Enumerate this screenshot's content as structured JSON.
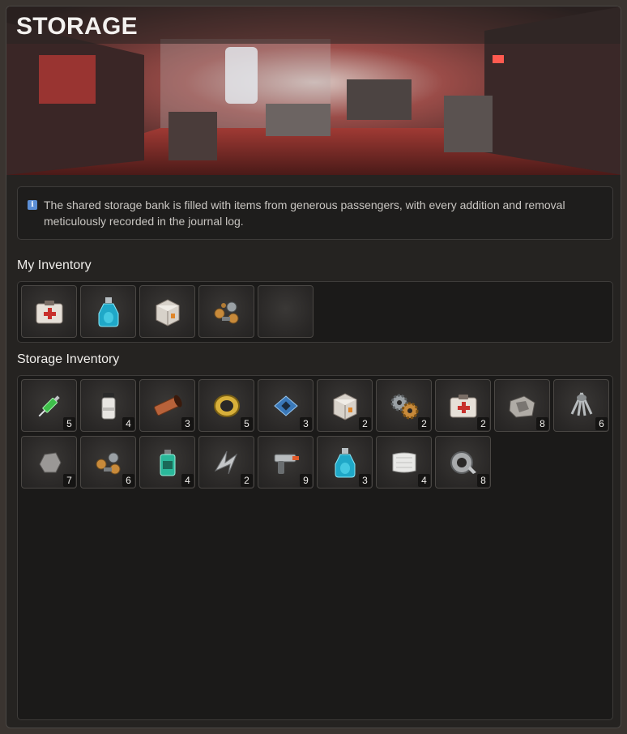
{
  "header": {
    "title": "STORAGE"
  },
  "notice": {
    "icon": "info-icon",
    "text": "The shared storage bank is filled with items from generous passengers, with every addition and removal meticulously recorded in the journal log."
  },
  "my_inventory": {
    "label": "My Inventory",
    "items": [
      {
        "icon": "medkit-icon"
      },
      {
        "icon": "potion-bottle-icon"
      },
      {
        "icon": "supply-crate-icon"
      },
      {
        "icon": "scrap-parts-icon"
      },
      {
        "icon": "empty-slot"
      }
    ]
  },
  "storage_inventory": {
    "label": "Storage Inventory",
    "items": [
      {
        "icon": "syringe-icon",
        "qty": "5"
      },
      {
        "icon": "canister-icon",
        "qty": "4"
      },
      {
        "icon": "copper-pipe-icon",
        "qty": "3"
      },
      {
        "icon": "metal-ring-icon",
        "qty": "5"
      },
      {
        "icon": "circuit-board-icon",
        "qty": "3"
      },
      {
        "icon": "supply-crate-icon",
        "qty": "2"
      },
      {
        "icon": "gears-icon",
        "qty": "2"
      },
      {
        "icon": "medkit-icon",
        "qty": "2"
      },
      {
        "icon": "scrap-metal-icon",
        "qty": "8"
      },
      {
        "icon": "claw-frame-icon",
        "qty": "6"
      },
      {
        "icon": "rock-icon",
        "qty": "7"
      },
      {
        "icon": "scrap-parts-icon",
        "qty": "6"
      },
      {
        "icon": "battery-icon",
        "qty": "4"
      },
      {
        "icon": "metal-shards-icon",
        "qty": "2"
      },
      {
        "icon": "tool-gun-icon",
        "qty": "9"
      },
      {
        "icon": "potion-bottle-icon",
        "qty": "3"
      },
      {
        "icon": "cloth-icon",
        "qty": "4"
      },
      {
        "icon": "tape-roll-icon",
        "qty": "8"
      }
    ]
  },
  "colors": {
    "accent": "#5c8fd6",
    "panel": "#1b1a19",
    "frame": "#252321"
  }
}
